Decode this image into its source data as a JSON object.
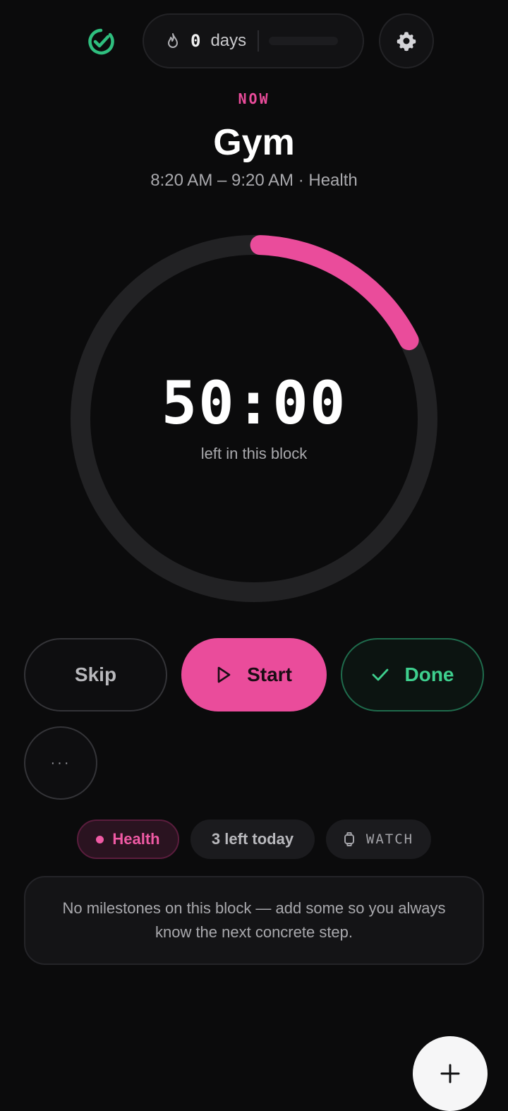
{
  "header": {
    "logo_icon": "check-circle-icon",
    "streak": {
      "count": "0",
      "unit": "days",
      "icon": "flame-icon"
    },
    "settings_icon": "gear-icon"
  },
  "block": {
    "status": "NOW",
    "title": "Gym",
    "time_range": "8:20 AM – 9:20 AM · Health"
  },
  "timer": {
    "display": "50:00",
    "caption": "left in this block",
    "progress": 0.17,
    "accent_color": "#ea4c9b",
    "track_color": "#222224"
  },
  "actions": {
    "skip_label": "Skip",
    "start_label": "Start",
    "done_label": "Done",
    "more_label": "···"
  },
  "chips": {
    "category": "Health",
    "remaining": "3 left today",
    "watch": "WATCH"
  },
  "milestones": {
    "empty_text": "No milestones on this block — add some so you always know the next concrete step."
  },
  "colors": {
    "background": "#0b0b0c",
    "accent": "#ea4c9b",
    "success": "#3ecf8e"
  }
}
